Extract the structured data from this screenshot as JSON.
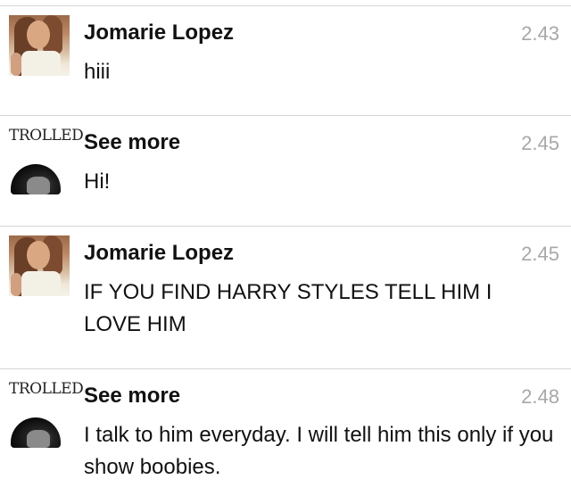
{
  "messages": [
    {
      "sender": "Jomarie Lopez",
      "time": "2.43",
      "text": "hiii",
      "avatar": "girl-photo"
    },
    {
      "sender": "See more",
      "time": "2.45",
      "text": "Hi!",
      "avatar": "trolled-hood",
      "avatar_label": "TROLLED"
    },
    {
      "sender": "Jomarie Lopez",
      "time": "2.45",
      "text": "IF YOU FIND HARRY STYLES TELL HIM I LOVE HIM",
      "avatar": "girl-photo"
    },
    {
      "sender": "See more",
      "time": "2.48",
      "text": "I talk to him everyday. I will tell him this only if you show boobies.",
      "avatar": "trolled-hood",
      "avatar_label": "TROLLED"
    }
  ],
  "colors": {
    "timestamp": "#a8a8a8",
    "divider": "#d6d6d6",
    "text": "#111111"
  }
}
